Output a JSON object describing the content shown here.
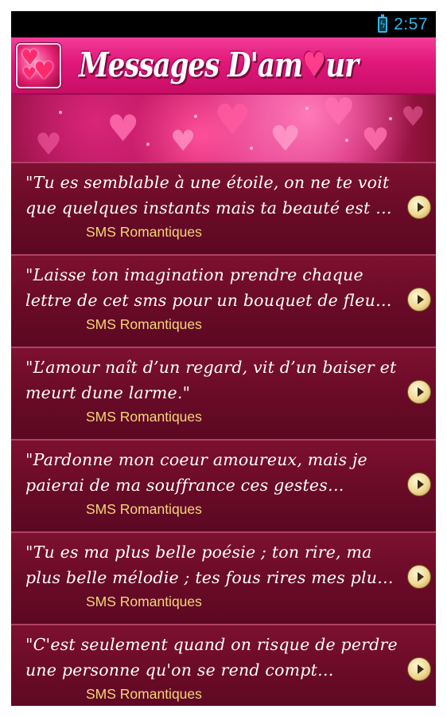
{
  "status_bar": {
    "time": "2:57",
    "battery_icon": "battery-charging-icon"
  },
  "app_bar": {
    "title_before": "Messages D'am",
    "title_heart": "♥",
    "title_after": "ur",
    "icon": "hearts-app-icon"
  },
  "messages": [
    {
      "text": "\"Tu es semblable à une étoile, on ne te voit que quelques instants mais ta beauté est …",
      "category": "SMS Romantiques"
    },
    {
      "text": "\"Laisse ton imagination prendre chaque lettre de cet sms pour un bouquet de fleu…",
      "category": "SMS Romantiques"
    },
    {
      "text": "\"L’amour naît d’un regard, vit d’un baiser et meurt dune larme.\"",
      "category": "SMS Romantiques"
    },
    {
      "text": "\"Pardonne mon coeur amoureux, mais je paierai de ma souffrance ces gestes…",
      "category": "SMS Romantiques"
    },
    {
      "text": "\"Tu es ma plus belle poésie ; ton rire, ma plus belle mélodie ; tes fous rires mes plu…",
      "category": "SMS Romantiques"
    },
    {
      "text": "\"C'est seulement quand on risque de perdre une personne qu'on se rend compt…",
      "category": "SMS Romantiques"
    }
  ],
  "colors": {
    "accent": "#e0187a",
    "list_bg": "#6a0b28",
    "category_text": "#f3d77a",
    "status_text": "#33b5e5"
  }
}
